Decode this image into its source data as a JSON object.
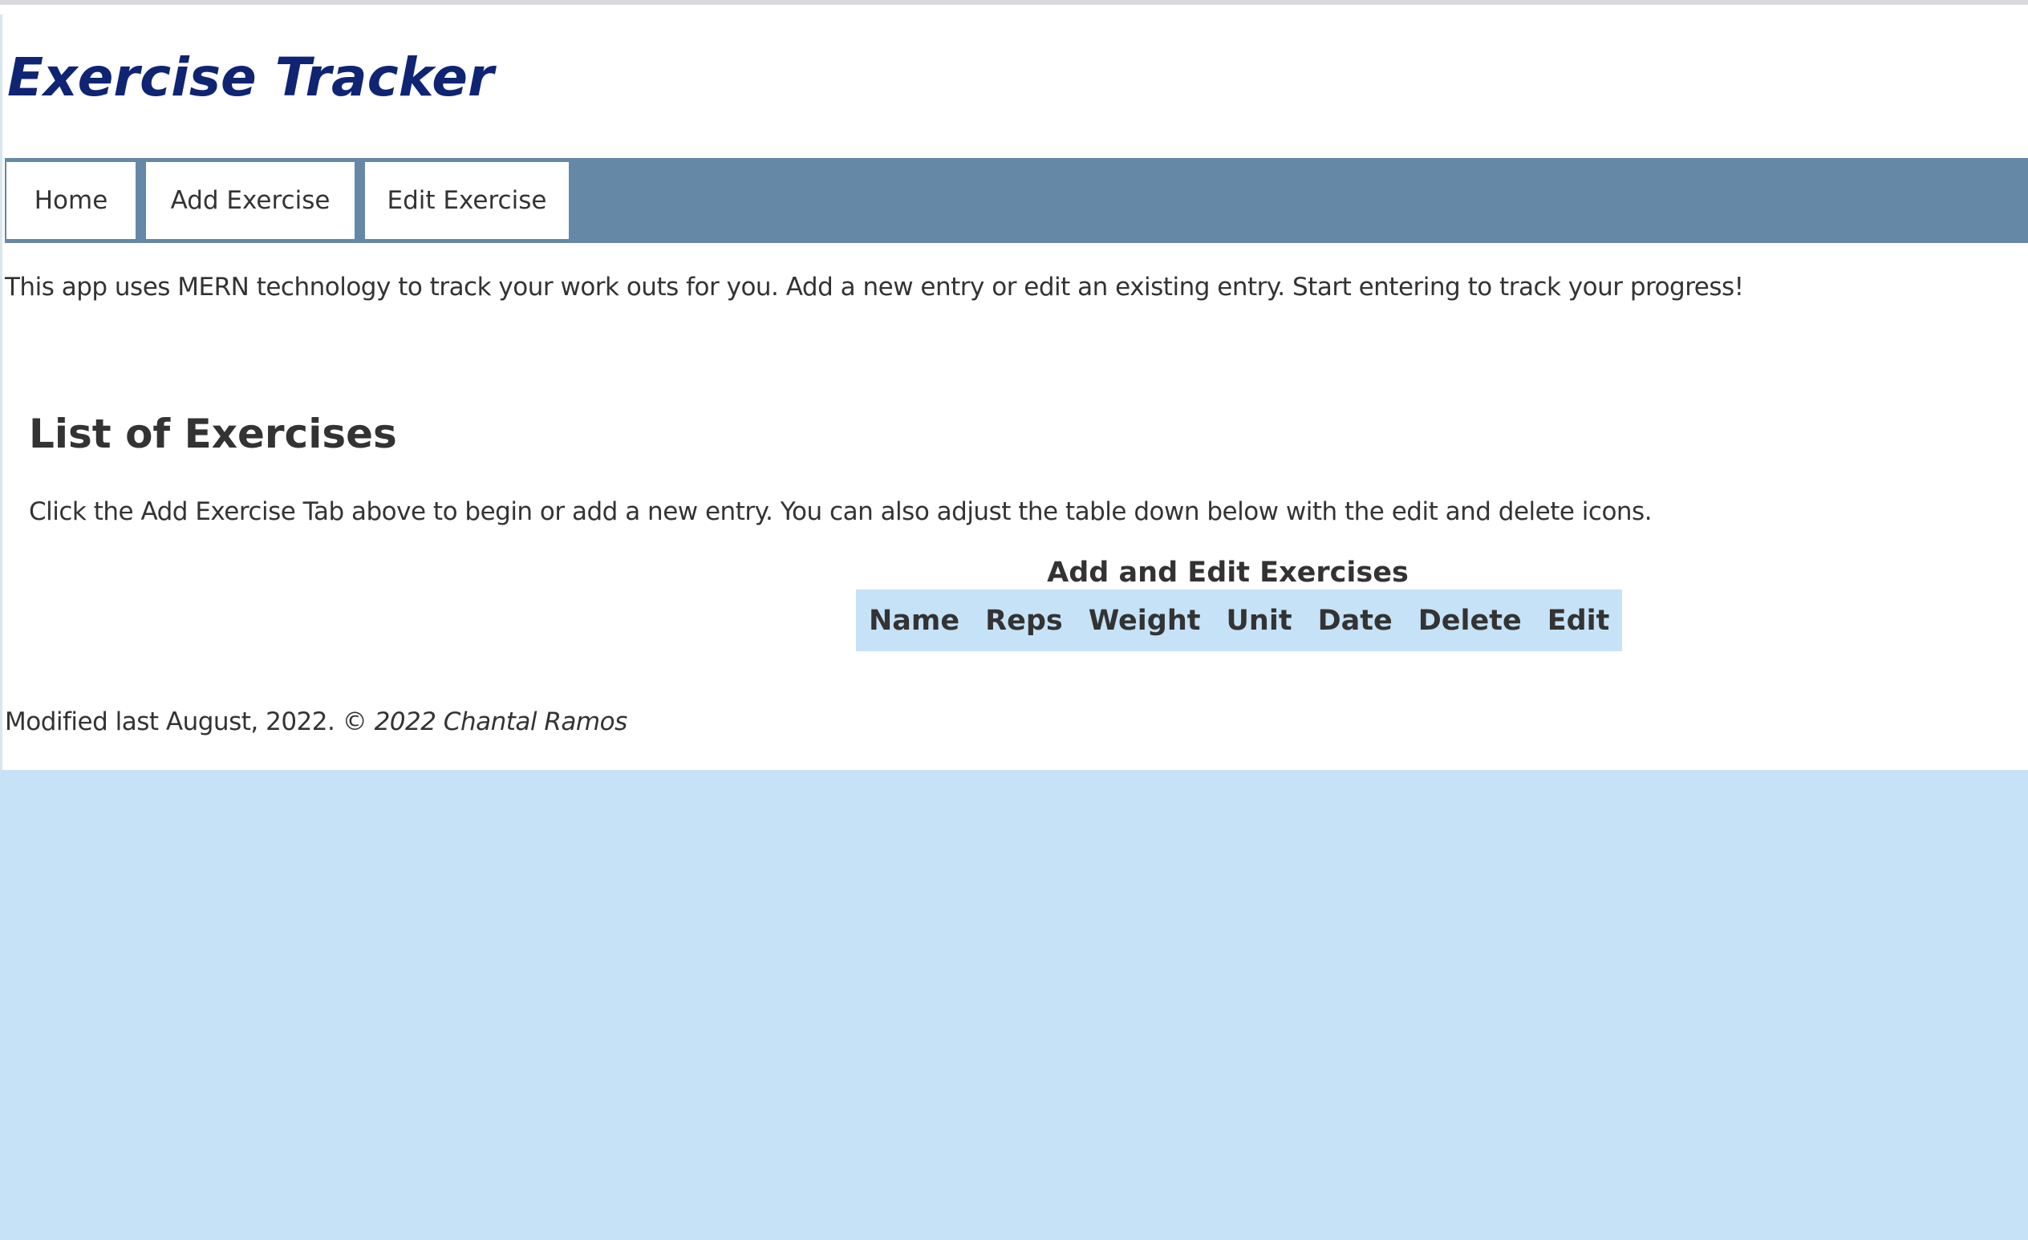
{
  "header": {
    "title": "Exercise Tracker"
  },
  "nav": {
    "items": [
      {
        "label": "Home"
      },
      {
        "label": "Add Exercise"
      },
      {
        "label": "Edit Exercise"
      }
    ]
  },
  "main": {
    "intro": "This app uses MERN technology to track your work outs for you. Add a new entry or edit an existing entry. Start entering to track your progress!",
    "section_title": "List of Exercises",
    "section_desc": "Click the Add Exercise Tab above to begin or add a new entry. You can also adjust the table down below with the edit and delete icons.",
    "table": {
      "caption": "Add and Edit Exercises",
      "columns": [
        "Name",
        "Reps",
        "Weight",
        "Unit",
        "Date",
        "Delete",
        "Edit"
      ],
      "rows": []
    }
  },
  "footer": {
    "text": "Modified last August, 2022. ©",
    "author": "2022 Chantal Ramos"
  },
  "colors": {
    "title": "#0f2472",
    "nav_bar": "#6588a7",
    "page_background": "#c6e2f7",
    "table_header": "#c6e2f7",
    "text": "#333333"
  }
}
